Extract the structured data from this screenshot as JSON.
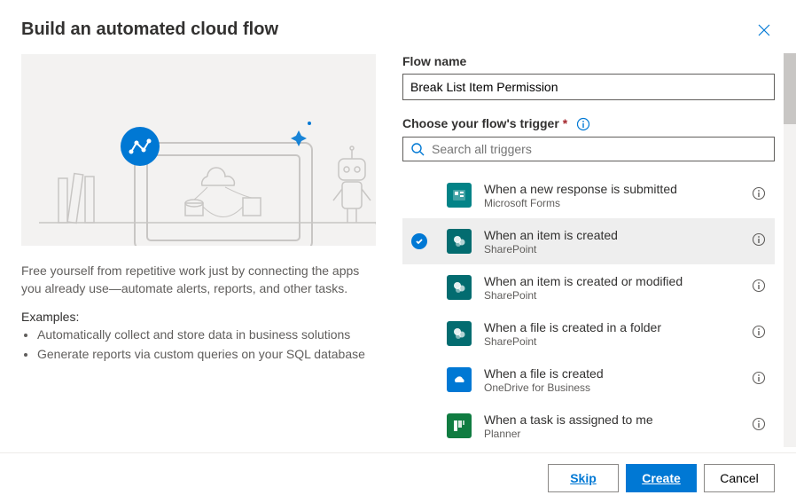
{
  "header": {
    "title": "Build an automated cloud flow"
  },
  "left": {
    "description": "Free yourself from repetitive work just by connecting the apps you already use—automate alerts, reports, and other tasks.",
    "examples_label": "Examples:",
    "examples": [
      "Automatically collect and store data in business solutions",
      "Generate reports via custom queries on your SQL database"
    ]
  },
  "right": {
    "flow_name_label": "Flow name",
    "flow_name_value": "Break List Item Permission",
    "trigger_label": "Choose your flow's trigger",
    "search_placeholder": "Search all triggers",
    "triggers": [
      {
        "title": "When a new response is submitted",
        "connector": "Microsoft Forms",
        "selected": false,
        "color": "#038387",
        "icon": "forms"
      },
      {
        "title": "When an item is created",
        "connector": "SharePoint",
        "selected": true,
        "color": "#036c70",
        "icon": "sharepoint"
      },
      {
        "title": "When an item is created or modified",
        "connector": "SharePoint",
        "selected": false,
        "color": "#036c70",
        "icon": "sharepoint"
      },
      {
        "title": "When a file is created in a folder",
        "connector": "SharePoint",
        "selected": false,
        "color": "#036c70",
        "icon": "sharepoint"
      },
      {
        "title": "When a file is created",
        "connector": "OneDrive for Business",
        "selected": false,
        "color": "#0078d4",
        "icon": "onedrive"
      },
      {
        "title": "When a task is assigned to me",
        "connector": "Planner",
        "selected": false,
        "color": "#107c41",
        "icon": "planner"
      }
    ]
  },
  "footer": {
    "skip": "Skip",
    "create": "Create",
    "cancel": "Cancel"
  }
}
